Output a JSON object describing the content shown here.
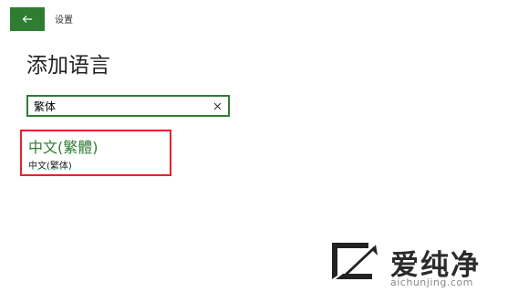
{
  "header": {
    "back_icon": "arrow-left-icon",
    "window_title": "设置"
  },
  "page": {
    "title": "添加语言"
  },
  "search": {
    "value": "繁体",
    "clear_icon": "close-icon"
  },
  "results": [
    {
      "native_name": "中文(繁體)",
      "local_name": "中文(繁体)"
    }
  ],
  "watermark": {
    "brand": "爱纯净",
    "url": "aichunjing.com"
  },
  "colors": {
    "accent": "#2e7d32",
    "highlight_border": "#e8202a"
  }
}
